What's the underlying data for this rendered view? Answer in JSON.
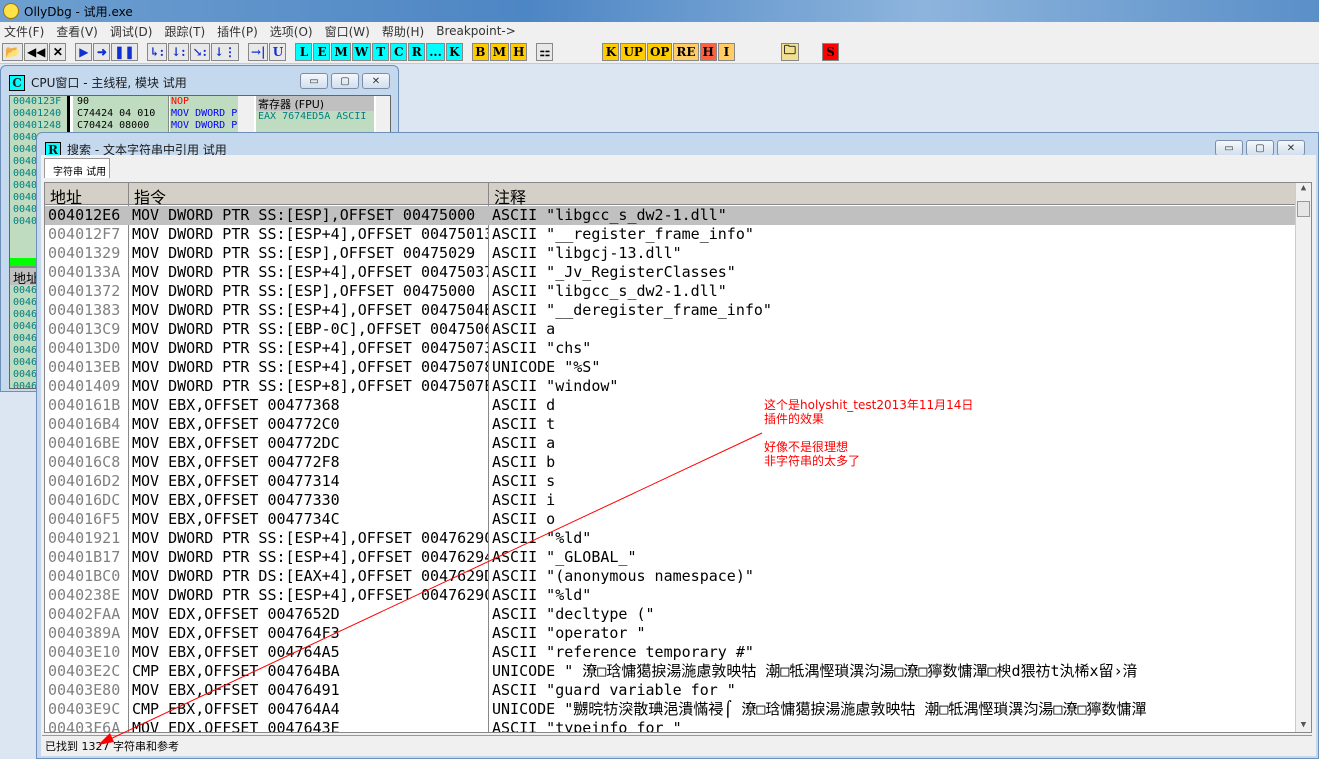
{
  "app": {
    "title": "OllyDbg - 试用.exe"
  },
  "menu": [
    "文件(F)",
    "查看(V)",
    "调试(D)",
    "跟踪(T)",
    "插件(P)",
    "选项(O)",
    "窗口(W)",
    "帮助(H)",
    "Breakpoint->"
  ],
  "toolbar": {
    "group1": [
      {
        "label": "📂",
        "name": "open-icon"
      },
      {
        "label": "◀◀",
        "name": "restart-icon"
      },
      {
        "label": "✕",
        "name": "close-icon"
      }
    ],
    "group2": [
      {
        "label": "▶",
        "name": "run-icon"
      },
      {
        "label": "➜",
        "name": "run-thread-icon"
      },
      {
        "label": "❚❚",
        "name": "pause-icon"
      }
    ],
    "group3": [
      {
        "label": "↳:",
        "name": "step-into-icon"
      },
      {
        "label": "↓:",
        "name": "step-over-icon"
      },
      {
        "label": "↘:",
        "name": "trace-into-icon"
      },
      {
        "label": "↓⋮",
        "name": "trace-over-icon"
      }
    ],
    "group4": [
      {
        "label": "→|",
        "name": "execute-till-return-icon"
      },
      {
        "label": "U",
        "name": "execute-till-user-code-icon"
      }
    ],
    "windows": [
      "L",
      "E",
      "M",
      "W",
      "T",
      "C",
      "R",
      "...",
      "K"
    ],
    "bmh": [
      "B",
      "M",
      "H"
    ],
    "plugins": [
      "K",
      "UP",
      "OP",
      "RE",
      "H",
      "I"
    ],
    "s": "S"
  },
  "cpu_window": {
    "icon": "C",
    "title": "CPU窗口 - 主线程, 模块 试用",
    "addresses": [
      "0040123F",
      "00401240",
      "00401248",
      "0040",
      "0040",
      "0040",
      "0040",
      "0040",
      "0040",
      "0040",
      "0040"
    ],
    "hex": [
      "90",
      "C74424 04 010",
      "C70424 08000"
    ],
    "disasm": [
      "NOP",
      "MOV DWORD P",
      "MOV DWORD P"
    ],
    "registers_header": "寄存器 (FPU)",
    "registers": [
      "EAX 7674ED5A ASCII"
    ],
    "dump_header": "地址",
    "dump_addresses": [
      "0046",
      "0046",
      "0046",
      "0046",
      "0046",
      "0046",
      "0046",
      "0046",
      "0046"
    ]
  },
  "search_window": {
    "icon": "R",
    "title": "搜索 - 文本字符串中引用 试用",
    "tab": "字符串 试用",
    "columns": [
      "地址",
      "指令",
      "注释"
    ],
    "rows": [
      {
        "addr": "004012E6",
        "instr": "MOV DWORD PTR SS:[ESP],OFFSET 00475000",
        "comment": "ASCII \"libgcc_s_dw2-1.dll\""
      },
      {
        "addr": "004012F7",
        "instr": "MOV DWORD PTR SS:[ESP+4],OFFSET 00475013",
        "comment": "ASCII \"__register_frame_info\""
      },
      {
        "addr": "00401329",
        "instr": "MOV DWORD PTR SS:[ESP],OFFSET 00475029",
        "comment": "ASCII \"libgcj-13.dll\""
      },
      {
        "addr": "0040133A",
        "instr": "MOV DWORD PTR SS:[ESP+4],OFFSET 00475037",
        "comment": "ASCII \"_Jv_RegisterClasses\""
      },
      {
        "addr": "00401372",
        "instr": "MOV DWORD PTR SS:[ESP],OFFSET 00475000",
        "comment": "ASCII \"libgcc_s_dw2-1.dll\""
      },
      {
        "addr": "00401383",
        "instr": "MOV DWORD PTR SS:[ESP+4],OFFSET 0047504B",
        "comment": "ASCII \"__deregister_frame_info\""
      },
      {
        "addr": "004013C9",
        "instr": "MOV DWORD PTR SS:[EBP-0C],OFFSET 00475063",
        "comment": "ASCII a"
      },
      {
        "addr": "004013D0",
        "instr": "MOV DWORD PTR SS:[ESP+4],OFFSET 00475073",
        "comment": "ASCII \"chs\""
      },
      {
        "addr": "004013EB",
        "instr": "MOV DWORD PTR SS:[ESP+4],OFFSET 00475078",
        "comment": "UNICODE \"%S\""
      },
      {
        "addr": "00401409",
        "instr": "MOV DWORD PTR SS:[ESP+8],OFFSET 0047507E",
        "comment": "ASCII \"window\""
      },
      {
        "addr": "0040161B",
        "instr": "MOV EBX,OFFSET 00477368",
        "comment": "ASCII d"
      },
      {
        "addr": "004016B4",
        "instr": "MOV EBX,OFFSET 004772C0",
        "comment": "ASCII t"
      },
      {
        "addr": "004016BE",
        "instr": "MOV EBX,OFFSET 004772DC",
        "comment": "ASCII a"
      },
      {
        "addr": "004016C8",
        "instr": "MOV EBX,OFFSET 004772F8",
        "comment": "ASCII b"
      },
      {
        "addr": "004016D2",
        "instr": "MOV EBX,OFFSET 00477314",
        "comment": "ASCII s"
      },
      {
        "addr": "004016DC",
        "instr": "MOV EBX,OFFSET 00477330",
        "comment": "ASCII i"
      },
      {
        "addr": "004016F5",
        "instr": "MOV EBX,OFFSET 0047734C",
        "comment": "ASCII o"
      },
      {
        "addr": "00401921",
        "instr": "MOV DWORD PTR SS:[ESP+4],OFFSET 00476290",
        "comment": "ASCII \"%ld\""
      },
      {
        "addr": "00401B17",
        "instr": "MOV DWORD PTR SS:[ESP+4],OFFSET 00476294",
        "comment": "ASCII \"_GLOBAL_\""
      },
      {
        "addr": "00401BC0",
        "instr": "MOV DWORD PTR DS:[EAX+4],OFFSET 0047629D",
        "comment": "ASCII \"(anonymous namespace)\""
      },
      {
        "addr": "0040238E",
        "instr": "MOV DWORD PTR SS:[ESP+4],OFFSET 00476290",
        "comment": "ASCII \"%ld\""
      },
      {
        "addr": "00402FAA",
        "instr": "MOV EDX,OFFSET 0047652D",
        "comment": "ASCII \"decltype (\""
      },
      {
        "addr": "0040389A",
        "instr": "MOV EDX,OFFSET 004764F3",
        "comment": "ASCII \"operator \""
      },
      {
        "addr": "00403E10",
        "instr": "MOV EBX,OFFSET 004764A5",
        "comment": "ASCII \"reference temporary #\""
      },
      {
        "addr": "00403E2C",
        "instr": "CMP EBX,OFFSET 004764BA",
        "comment": "UNICODE \" 潦□琀慵獦捩湯湤慮敦映牯 潮□牴湡慳瑣潩汮湯□潦□獰数慵潬□楰d猥祊t汍桸x留›湇"
      },
      {
        "addr": "00403E80",
        "instr": "MOV EBX,OFFSET 00476491",
        "comment": "ASCII \"guard variable for \""
      },
      {
        "addr": "00403E9C",
        "instr": "CMP EBX,OFFSET 004764A4",
        "comment": "UNICODE \"嬲晥牥湥散琠浥潰慲祲⌠ 潦□琀慵獦捩湯湤慮敦映牯 潮□牴湡慳瑣潩汮湯□潦□獰数慵潬"
      },
      {
        "addr": "00403F6A",
        "instr": "MOV EDX,OFFSET 0047643E",
        "comment": "ASCII \"typeinfo for \""
      }
    ],
    "status": "已找到 1327 字符串和参考"
  },
  "annotation": {
    "lines": [
      "这个是holyshit_test2013年11月14日",
      "插件的效果",
      "",
      "好像不是很理想",
      "非字符串的太多了"
    ],
    "color": "#ff0000"
  }
}
